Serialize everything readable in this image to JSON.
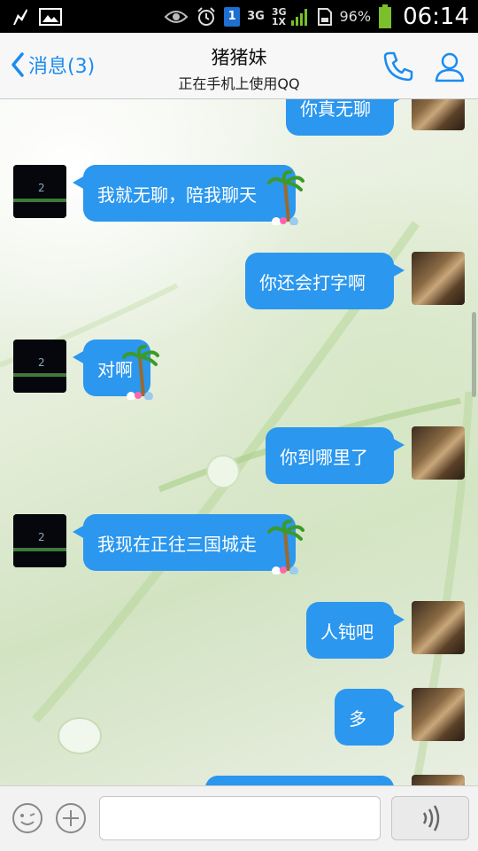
{
  "status_bar": {
    "icons_left": [
      "lightning-icon",
      "image-icon"
    ],
    "icons_right": [
      "eye-icon",
      "alarm-icon",
      "sim-icon",
      "signal-icon",
      "sd-card-icon",
      "battery-icon"
    ],
    "net1": "3G",
    "net2": "3G",
    "net2_sub": "1X",
    "sim_number": "1",
    "battery": "96%",
    "time": "06:14"
  },
  "header": {
    "back_label": "消息(3)",
    "title": "猪猪妹",
    "subtitle": "正在手机上使用QQ",
    "accent": "#1a8cf0"
  },
  "messages": [
    {
      "side": "out",
      "text": "你真无聊"
    },
    {
      "side": "in",
      "text": "我就无聊，陪我聊天"
    },
    {
      "side": "out",
      "text": "你还会打字啊"
    },
    {
      "side": "in",
      "text": "对啊"
    },
    {
      "side": "out",
      "text": "你到哪里了"
    },
    {
      "side": "in",
      "text": "我现在正往三国城走"
    },
    {
      "side": "out",
      "text": "人钝吧"
    },
    {
      "side": "out",
      "text": "多"
    }
  ],
  "input_bar": {
    "placeholder": "",
    "icons": [
      "emoji-icon",
      "plus-icon",
      "voice-icon"
    ]
  },
  "colors": {
    "bubble": "#2b97ee"
  }
}
